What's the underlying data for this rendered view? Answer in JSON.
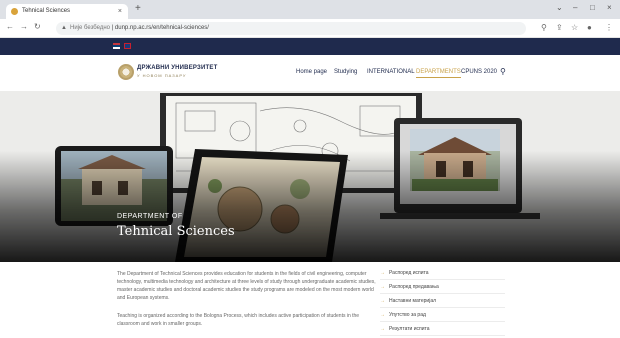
{
  "browser": {
    "tab_title": "Tehnical Sciences",
    "tab_close": "×",
    "new_tab": "+",
    "url_secure_label": "Није безбедно",
    "url_separator": " | ",
    "url": "dunp.np.ac.rs/en/tehnical-sciences/",
    "window_controls": [
      "⌄",
      "–",
      "□",
      "×"
    ]
  },
  "site": {
    "logo_name": "ДРЖАВНИ УНИВЕРЗИТЕТ",
    "logo_sub": "У НОВОМ ПАЗАРУ",
    "menu": [
      "Home page",
      "Studying",
      "INTERNATIONAL",
      "DEPARTMENTS",
      "CPUNS 2020"
    ],
    "active_menu_index": 3
  },
  "hero": {
    "kicker": "DEPARTMENT OF",
    "title": "Tehnical Sciences"
  },
  "content": {
    "paragraph_1": "The Department of Technical Sciences provides education for students in the fields of civil engineering, computer technology, multimedia technology and architecture at three levels of study through undergraduate academic studies, master academic studies and doctoral academic studies the study programs are modeled on the most modern world and European systems.",
    "paragraph_2": "Teaching is organized according to the Bologna Process, which includes active participation of students in the classroom and work in smaller groups.",
    "side_links": [
      "Распоред испита",
      "Распоред предавања",
      "Наставни материјал",
      "Упутство за рад",
      "Резултати испита"
    ]
  },
  "colors": {
    "navy": "#1f2a4d",
    "gold": "#c9a24a"
  }
}
